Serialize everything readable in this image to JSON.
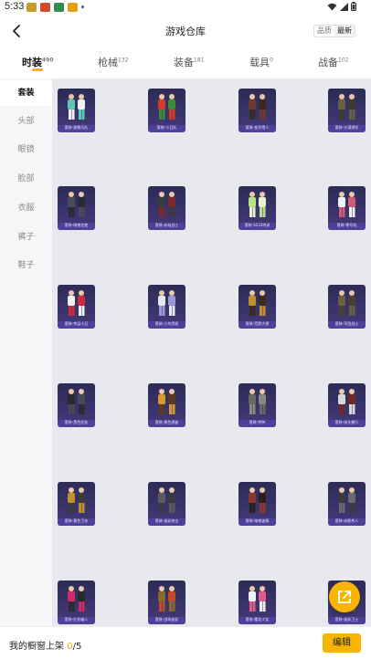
{
  "status": {
    "time": "5:33",
    "app_icon_colors": [
      "#c79a2a",
      "#d24b2b",
      "#2f8d4e",
      "#e2a010"
    ]
  },
  "header": {
    "title": "游戏仓库",
    "sort_options": [
      "品质",
      "最新"
    ],
    "sort_active": "最新"
  },
  "tabs": [
    {
      "label": "时装",
      "count": "490",
      "active": true
    },
    {
      "label": "枪械",
      "count": "132",
      "active": false
    },
    {
      "label": "装备",
      "count": "181",
      "active": false
    },
    {
      "label": "载具",
      "count": "0",
      "active": false
    },
    {
      "label": "战备",
      "count": "102",
      "active": false
    }
  ],
  "sidebar": [
    {
      "label": "套装",
      "active": true
    },
    {
      "label": "头部",
      "active": false
    },
    {
      "label": "眼镜",
      "active": false
    },
    {
      "label": "脸部",
      "active": false
    },
    {
      "label": "衣服",
      "active": false
    },
    {
      "label": "裤子",
      "active": false
    },
    {
      "label": "鞋子",
      "active": false
    }
  ],
  "items": [
    {
      "label": "套装-甜蜜乐队",
      "colors": [
        "#5fc7b8",
        "#f2f2f2"
      ]
    },
    {
      "label": "套装-小丑队",
      "colors": [
        "#d8392b",
        "#3a8a3a"
      ]
    },
    {
      "label": "套装-变异猎人",
      "colors": [
        "#6b3a2a",
        "#3a2a22"
      ]
    },
    {
      "label": "套装-沙漠潜伏",
      "colors": [
        "#6a6048",
        "#3e3a30"
      ]
    },
    {
      "label": "套装-暗夜信使",
      "colors": [
        "#4a4a58",
        "#2a2a34"
      ]
    },
    {
      "label": "套装-赤焰战士",
      "colors": [
        "#3a3a40",
        "#7a2a2a"
      ]
    },
    {
      "label": "套装-SS33特训",
      "colors": [
        "#b8e08a",
        "#e8f0d0"
      ]
    },
    {
      "label": "套装-零号机",
      "colors": [
        "#f0f0f8",
        "#d05a7a"
      ]
    },
    {
      "label": "套装-幸运小丑",
      "colors": [
        "#f0f0f0",
        "#d02a3a"
      ]
    },
    {
      "label": "套装-小鸟伊丽",
      "colors": [
        "#e8e8f2",
        "#9a9ad8"
      ]
    },
    {
      "label": "套装-荒野大镖",
      "colors": [
        "#c09030",
        "#3a2a20"
      ]
    },
    {
      "label": "套装-军团战士",
      "colors": [
        "#6a6040",
        "#4a4030"
      ]
    },
    {
      "label": "套装-黑色狂徒",
      "colors": [
        "#2a2a30",
        "#4a4a54"
      ]
    },
    {
      "label": "套装-黄色潜者",
      "colors": [
        "#d89a30",
        "#5a3a20"
      ]
    },
    {
      "label": "套装-特种",
      "colors": [
        "#6a6860",
        "#8a8880"
      ]
    },
    {
      "label": "套装-街头霸行",
      "colors": [
        "#d8d8d8",
        "#6a2a2a"
      ]
    },
    {
      "label": "套装-黄色卫衣",
      "colors": [
        "#c0902a",
        "#3a3a3a"
      ]
    },
    {
      "label": "套装-迷彩突击",
      "colors": [
        "#5a5a60",
        "#3a3a44"
      ]
    },
    {
      "label": "套装-暗夜迷情",
      "colors": [
        "#8a3a2a",
        "#2a2020"
      ]
    },
    {
      "label": "套装-赤影杀人",
      "colors": [
        "#3a3a40",
        "#6a6a70"
      ]
    },
    {
      "label": "套装-红花幽人",
      "colors": [
        "#d02a6a",
        "#2a2a2a"
      ]
    },
    {
      "label": "套装-战场迷彩",
      "colors": [
        "#8a6a2a",
        "#c04a2a"
      ]
    },
    {
      "label": "套装-樱花少女",
      "colors": [
        "#f0f0f8",
        "#e05a8a"
      ]
    },
    {
      "label": "套装-迷彩卫士",
      "colors": [
        "#7a6a48",
        "#4a4030"
      ]
    }
  ],
  "footer": {
    "prefix": "我的橱窗上架 ",
    "current": "0",
    "sep": "/",
    "max": "5",
    "edit_label": "编辑"
  }
}
